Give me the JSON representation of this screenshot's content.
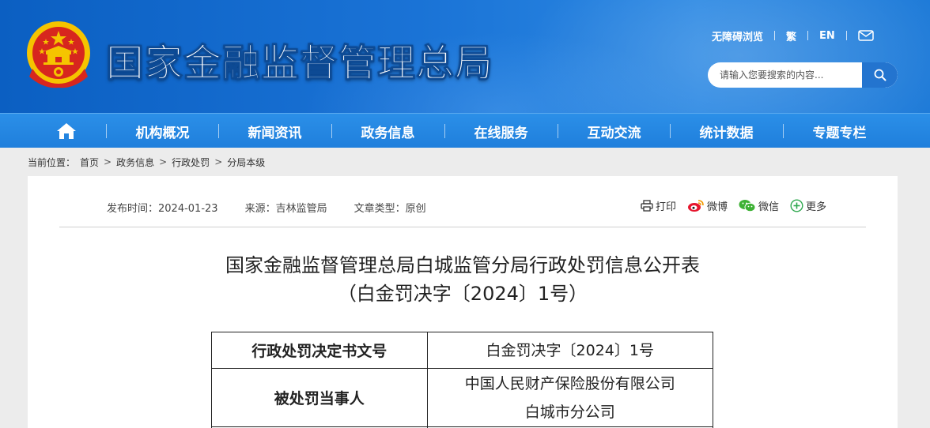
{
  "header": {
    "site_title": "国家金融监督管理总局",
    "top_links": {
      "accessible": "无障碍浏览",
      "traditional": "繁",
      "english": "EN"
    },
    "search": {
      "placeholder": "请输入您要搜索的内容..."
    },
    "colors": {
      "primary_blue": "#1a73d6",
      "nav_blue": "#2585e0",
      "emblem_red": "#d7261e",
      "emblem_gold": "#f5c400"
    }
  },
  "nav": {
    "home_icon": "home-icon",
    "items": [
      {
        "label": "机构概况"
      },
      {
        "label": "新闻资讯"
      },
      {
        "label": "政务信息"
      },
      {
        "label": "在线服务"
      },
      {
        "label": "互动交流"
      },
      {
        "label": "统计数据"
      },
      {
        "label": "专题专栏"
      }
    ]
  },
  "breadcrumb": {
    "prefix": "当前位置：",
    "items": [
      "首页",
      "政务信息",
      "行政处罚",
      "分局本级"
    ],
    "separator": ">"
  },
  "article": {
    "meta": {
      "publish_time": "发布时间：2024-01-23",
      "source": "来源：吉林监管局",
      "type": "文章类型：原创"
    },
    "share": {
      "print": "打印",
      "weibo": "微博",
      "wechat": "微信",
      "more": "更多"
    },
    "title_line1": "国家金融监督管理总局白城监管分局行政处罚信息公开表",
    "title_line2": "（白金罚决字〔2024〕1号）",
    "table": [
      {
        "key": "行政处罚决定书文号",
        "value_lines": [
          "白金罚决字〔2024〕1号"
        ]
      },
      {
        "key": "被处罚当事人",
        "value_lines": [
          "中国人民财产保险股份有限公司",
          "白城市分公司"
        ]
      }
    ]
  }
}
